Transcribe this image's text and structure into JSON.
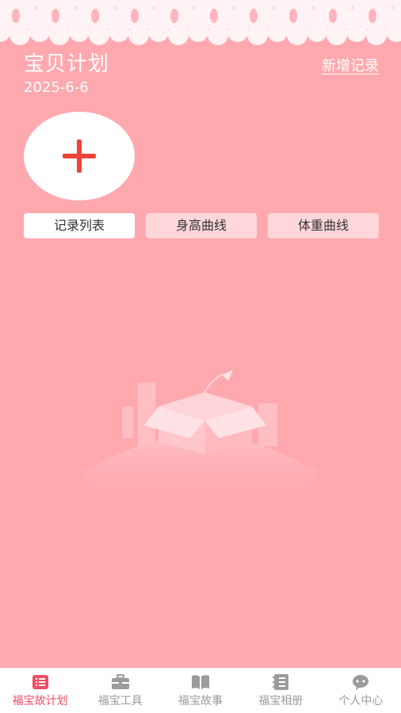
{
  "header": {
    "title": "宝贝计划",
    "date": "2025-6-6",
    "new_record_label": "新增记录"
  },
  "add_button": {
    "icon": "plus-icon"
  },
  "tabs": [
    {
      "label": "记录列表",
      "active": true
    },
    {
      "label": "身高曲线",
      "active": false
    },
    {
      "label": "体重曲线",
      "active": false
    }
  ],
  "empty_state": {
    "illustration": "empty-box-illustration"
  },
  "tabbar": {
    "items": [
      {
        "label": "福宝故计划",
        "icon": "list-icon",
        "active": true
      },
      {
        "label": "福宝工具",
        "icon": "toolbox-icon",
        "active": false
      },
      {
        "label": "福宝故事",
        "icon": "book-icon",
        "active": false
      },
      {
        "label": "福宝相册",
        "icon": "album-icon",
        "active": false
      },
      {
        "label": "个人中心",
        "icon": "chat-bubble-icon",
        "active": false
      }
    ]
  },
  "colors": {
    "background": "#FFA9AF",
    "accent_red": "#F0443A",
    "tab_inactive": "#FFD7DA",
    "tab_active": "#FFFFFF",
    "tabbar_active": "#F24E64",
    "tabbar_inactive": "#9B9B9B"
  }
}
